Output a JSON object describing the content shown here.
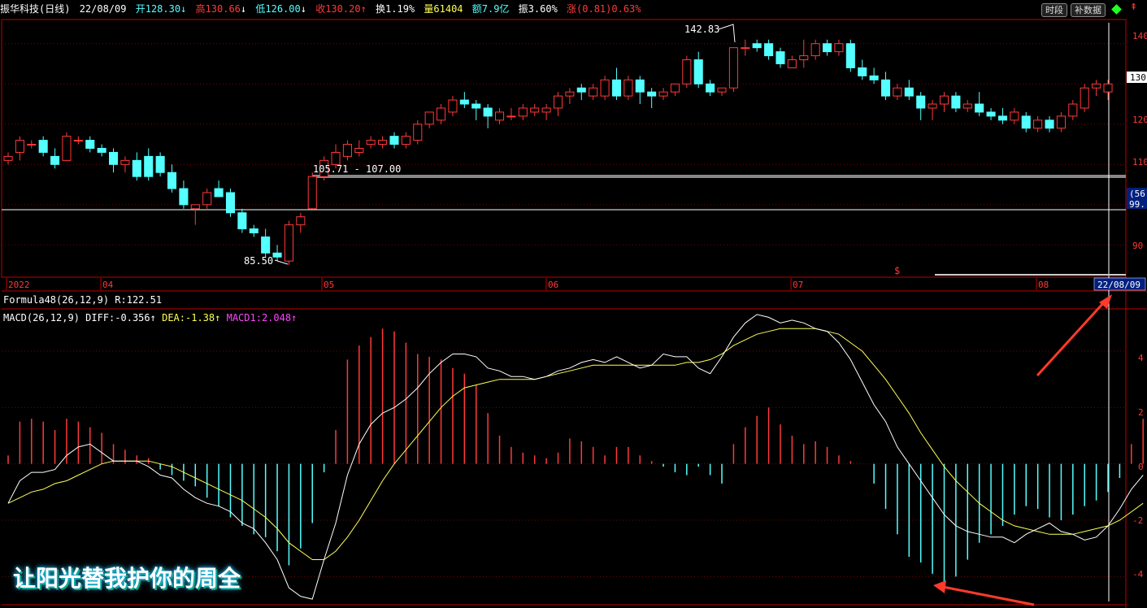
{
  "header": {
    "stock_name": "振华科技(日线)",
    "date": "22/08/09",
    "open": "开128.30",
    "high": "高130.66",
    "low": "低126.00",
    "close": "收130.20",
    "turnover": "换1.19%",
    "volume": "量61404",
    "amount": "额7.9亿",
    "amplitude": "振3.60%",
    "change": "涨(0.81)0.63%",
    "btn_timeshare": "时段",
    "btn_rights": "补数据"
  },
  "price_panel": {
    "high_label": "142.83",
    "low_label": "85.50",
    "gap_label": "105.71 - 107.00",
    "axis_ticks": [
      "140",
      "130",
      "120",
      "110",
      "90"
    ],
    "current_price_tag": "130",
    "cursor_tag_top": "(56",
    "cursor_tag_bottom": "99.",
    "marker_s": "$"
  },
  "time_axis": {
    "labels": [
      "2022",
      "04",
      "05",
      "06",
      "07",
      "08"
    ],
    "cursor_date": "22/08/09"
  },
  "formula_line": "Formula48(26,12,9) R:122.51",
  "macd": {
    "name": "MACD(26,12,9)",
    "diff": "DIFF:-0.356",
    "dea": "DEA:-1.38",
    "macd": "MACD1:2.048",
    "axis_ticks": [
      "4",
      "2",
      "0",
      "-2",
      "-4"
    ]
  },
  "caption": "让阳光替我护你的周全",
  "colors": {
    "up": "#ff3a3a",
    "down": "#54ffff",
    "grid": "#7a0000",
    "dea": "#ffff55",
    "diff": "#ffffff",
    "macd_label": "#ff44ff"
  },
  "chart_data": {
    "type": "candlestick",
    "ohlc": [
      [
        111,
        113,
        110,
        112
      ],
      [
        113,
        117,
        111,
        116
      ],
      [
        115,
        116,
        114,
        115
      ],
      [
        116,
        117,
        112,
        113
      ],
      [
        112,
        114,
        109,
        110
      ],
      [
        111,
        118,
        111,
        117
      ],
      [
        116,
        117,
        115,
        116
      ],
      [
        116,
        117,
        113,
        114
      ],
      [
        114,
        115,
        112,
        113
      ],
      [
        113,
        114,
        108,
        110
      ],
      [
        110,
        112,
        108,
        111
      ],
      [
        111,
        113,
        106,
        107
      ],
      [
        112,
        114,
        106,
        107
      ],
      [
        112,
        113,
        107,
        108
      ],
      [
        108,
        110,
        103,
        104
      ],
      [
        104,
        106,
        99,
        100
      ],
      [
        99,
        100,
        95,
        100
      ],
      [
        100,
        104,
        99,
        103
      ],
      [
        104,
        106,
        102,
        102
      ],
      [
        103,
        104,
        97,
        98
      ],
      [
        98,
        99,
        93,
        94
      ],
      [
        94,
        95,
        92,
        93
      ],
      [
        92,
        94,
        87,
        88
      ],
      [
        88,
        90,
        86,
        87
      ],
      [
        86,
        96,
        85,
        95
      ],
      [
        95,
        98,
        93,
        97
      ],
      [
        99,
        108,
        99,
        107
      ],
      [
        107,
        112,
        106,
        111
      ],
      [
        110,
        115,
        109,
        113
      ],
      [
        112,
        116,
        111,
        115
      ],
      [
        113,
        116,
        112,
        114
      ],
      [
        115,
        117,
        114,
        116
      ],
      [
        115,
        117,
        114,
        116
      ],
      [
        117,
        118,
        114,
        115
      ],
      [
        115,
        118,
        114,
        117
      ],
      [
        116,
        121,
        115,
        120
      ],
      [
        120,
        123,
        119,
        123
      ],
      [
        121,
        125,
        120,
        124
      ],
      [
        123,
        127,
        122,
        126
      ],
      [
        126,
        128,
        124,
        125
      ],
      [
        125,
        126,
        121,
        124
      ],
      [
        124,
        125,
        119,
        122
      ],
      [
        121,
        124,
        120,
        123
      ],
      [
        122,
        124,
        121,
        122
      ],
      [
        122,
        125,
        121,
        124
      ],
      [
        123,
        125,
        122,
        124
      ],
      [
        123,
        125,
        121,
        124
      ],
      [
        124,
        128,
        122,
        127
      ],
      [
        127,
        129,
        125,
        128
      ],
      [
        129,
        130,
        126,
        128
      ],
      [
        127,
        130,
        126,
        129
      ],
      [
        127,
        132,
        126,
        131
      ],
      [
        131,
        134,
        126,
        127
      ],
      [
        127,
        132,
        126,
        131
      ],
      [
        131,
        132,
        125,
        128
      ],
      [
        128,
        129,
        124,
        127
      ],
      [
        127,
        129,
        126,
        128
      ],
      [
        128,
        130,
        127,
        130
      ],
      [
        130,
        137,
        129,
        136
      ],
      [
        136,
        138,
        129,
        130
      ],
      [
        130,
        131,
        127,
        128
      ],
      [
        128,
        129,
        127,
        129
      ],
      [
        129,
        139,
        128,
        139
      ],
      [
        139,
        141,
        137,
        139
      ],
      [
        140,
        141,
        138,
        139
      ],
      [
        140,
        141,
        136,
        137
      ],
      [
        138,
        139,
        134,
        135
      ],
      [
        134,
        137,
        134,
        136
      ],
      [
        136,
        141,
        134,
        137
      ],
      [
        137,
        141,
        136,
        140
      ],
      [
        140,
        141,
        137,
        138
      ],
      [
        138,
        141,
        137,
        140
      ],
      [
        140,
        141,
        133,
        134
      ],
      [
        134,
        136,
        131,
        132
      ],
      [
        132,
        134,
        130,
        131
      ],
      [
        131,
        133,
        126,
        127
      ],
      [
        127,
        130,
        126,
        129
      ],
      [
        129,
        131,
        126,
        127
      ],
      [
        127,
        128,
        121,
        124
      ],
      [
        124,
        126,
        121,
        125
      ],
      [
        125,
        128,
        123,
        127
      ],
      [
        127,
        128,
        123,
        124
      ],
      [
        124,
        126,
        123,
        125
      ],
      [
        125,
        128,
        122,
        123
      ],
      [
        123,
        124,
        121,
        122
      ],
      [
        122,
        124,
        120,
        121
      ],
      [
        121,
        124,
        120,
        123
      ],
      [
        122,
        123,
        118,
        119
      ],
      [
        119,
        122,
        118,
        121
      ],
      [
        121,
        122,
        118,
        119
      ],
      [
        119,
        123,
        118,
        122
      ],
      [
        122,
        126,
        121,
        125
      ],
      [
        124,
        130,
        123,
        129
      ],
      [
        129,
        131,
        127,
        130
      ],
      [
        128,
        131,
        126,
        130
      ]
    ],
    "macd_hist": [
      0.3,
      1.5,
      1.6,
      1.5,
      1.2,
      1.6,
      1.5,
      1.3,
      1.1,
      0.7,
      0.5,
      0.3,
      0.2,
      -0.2,
      -0.4,
      -0.6,
      -0.8,
      -1.2,
      -1.5,
      -1.9,
      -2.2,
      -2.5,
      -2.6,
      -3.1,
      -3.6,
      -3.0,
      -2.1,
      -0.3,
      1.2,
      3.7,
      4.2,
      4.5,
      4.8,
      4.7,
      4.3,
      3.9,
      3.8,
      3.7,
      3.4,
      3.2,
      2.8,
      1.8,
      1.0,
      0.6,
      0.4,
      0.3,
      0.2,
      0.4,
      0.9,
      0.8,
      0.6,
      0.3,
      0.6,
      0.6,
      0.3,
      0.1,
      -0.1,
      -0.3,
      -0.4,
      -0.1,
      -0.4,
      -0.7,
      0.7,
      1.3,
      1.7,
      2.0,
      1.4,
      1.0,
      0.7,
      0.8,
      0.6,
      0.3,
      0.1,
      0,
      -0.7,
      -1.6,
      -2.5,
      -3.3,
      -3.5,
      -3.9,
      -4.3,
      -4.0,
      -3.4,
      -2.8,
      -2.5,
      -2.2,
      -1.8,
      -1.5,
      -1.6,
      -1.9,
      -2.0,
      -1.8,
      -1.5,
      -1.3,
      -1.0,
      -0.5,
      0.7,
      1.6
    ],
    "diff": [
      -1.4,
      -0.6,
      -0.3,
      -0.3,
      -0.2,
      0.3,
      0.6,
      0.7,
      0.4,
      0.1,
      0.1,
      0.1,
      -0.1,
      -0.4,
      -0.5,
      -0.9,
      -1.2,
      -1.4,
      -1.5,
      -1.7,
      -2.1,
      -2.3,
      -2.8,
      -3.4,
      -4.4,
      -4.7,
      -4.8,
      -3.4,
      -2.1,
      -0.4,
      0.7,
      1.4,
      1.8,
      2.0,
      2.3,
      2.7,
      3.2,
      3.6,
      3.9,
      3.9,
      3.8,
      3.4,
      3.3,
      3.1,
      3.1,
      3.0,
      3.1,
      3.3,
      3.4,
      3.6,
      3.7,
      3.6,
      3.8,
      3.6,
      3.4,
      3.5,
      3.9,
      3.8,
      3.8,
      3.4,
      3.2,
      3.8,
      4.5,
      5.0,
      5.3,
      5.2,
      5.0,
      5.1,
      5.0,
      4.8,
      4.7,
      4.3,
      3.7,
      2.9,
      2.1,
      1.5,
      0.6,
      0.0,
      -0.6,
      -1.2,
      -1.8,
      -2.2,
      -2.4,
      -2.5,
      -2.6,
      -2.6,
      -2.8,
      -2.5,
      -2.3,
      -2.1,
      -2.4,
      -2.5,
      -2.7,
      -2.6,
      -2.2,
      -1.6,
      -0.9,
      -0.4
    ],
    "dea": [
      -1.4,
      -1.2,
      -1.0,
      -0.9,
      -0.7,
      -0.6,
      -0.4,
      -0.2,
      0,
      0.1,
      0.1,
      0.1,
      0.1,
      0,
      -0.1,
      -0.3,
      -0.5,
      -0.7,
      -0.9,
      -1.1,
      -1.3,
      -1.6,
      -1.9,
      -2.3,
      -2.8,
      -3.1,
      -3.4,
      -3.4,
      -3.1,
      -2.6,
      -2.0,
      -1.3,
      -0.6,
      0,
      0.5,
      1.0,
      1.5,
      2.0,
      2.4,
      2.7,
      2.8,
      2.9,
      3.0,
      3.0,
      3.0,
      3.0,
      3.1,
      3.2,
      3.3,
      3.4,
      3.5,
      3.5,
      3.5,
      3.5,
      3.5,
      3.5,
      3.5,
      3.5,
      3.6,
      3.6,
      3.7,
      3.9,
      4.2,
      4.4,
      4.6,
      4.7,
      4.8,
      4.8,
      4.8,
      4.8,
      4.7,
      4.6,
      4.3,
      4.0,
      3.5,
      3.0,
      2.4,
      1.8,
      1.1,
      0.5,
      -0.1,
      -0.6,
      -1.0,
      -1.4,
      -1.7,
      -2.0,
      -2.2,
      -2.3,
      -2.4,
      -2.5,
      -2.5,
      -2.5,
      -2.4,
      -2.3,
      -2.2,
      -2.0,
      -1.7,
      -1.4
    ],
    "y_range_price": [
      82,
      146
    ],
    "y_range_macd": [
      -5,
      5.5
    ]
  }
}
